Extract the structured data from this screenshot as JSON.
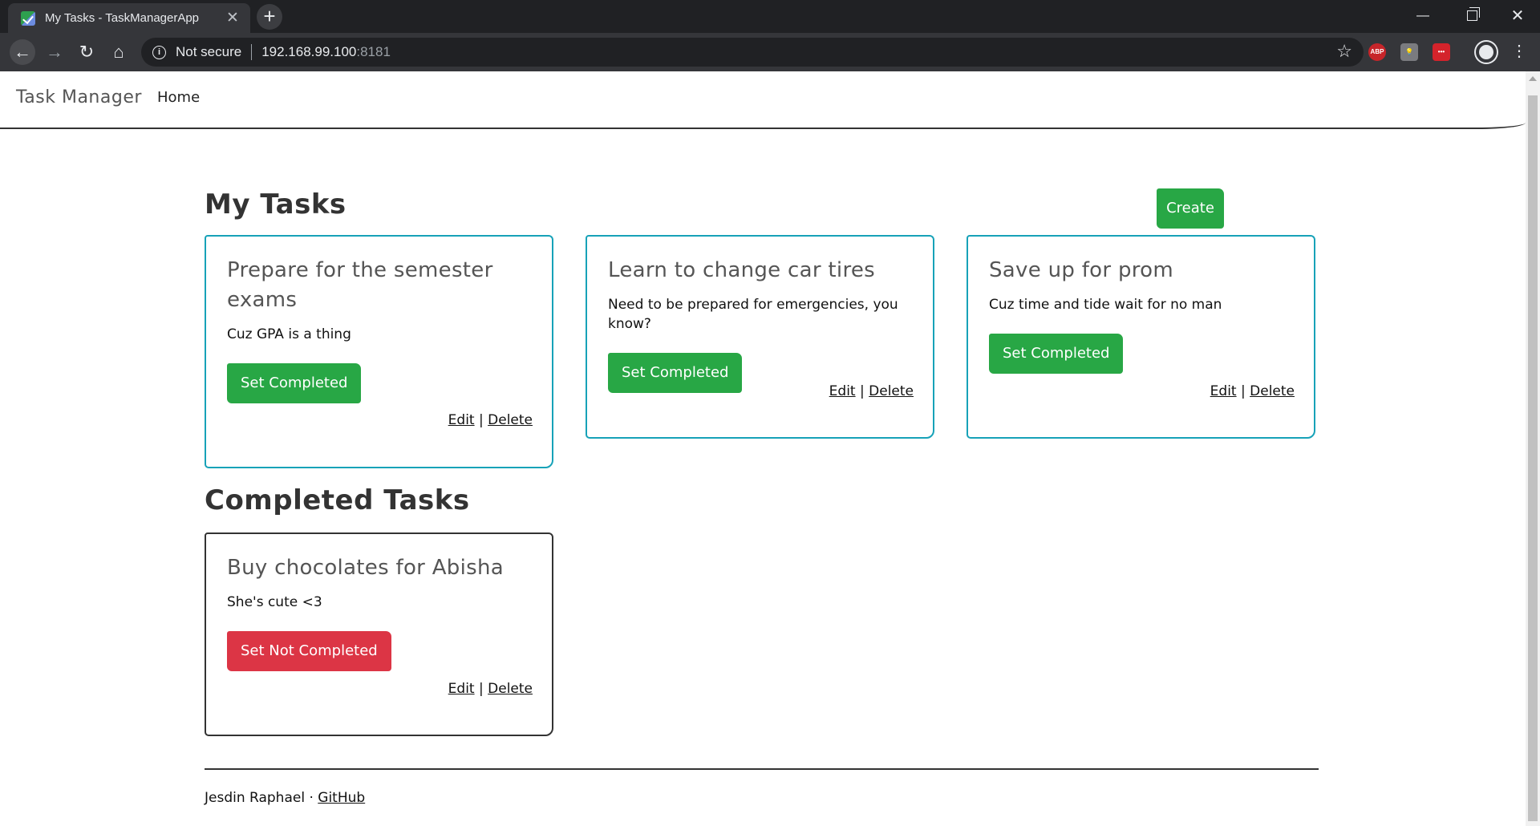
{
  "browser": {
    "tab_title": "My Tasks - TaskManagerApp",
    "security_label": "Not secure",
    "url_host": "192.168.99.100",
    "url_port": ":8181",
    "extensions": {
      "abp_label": "ABP",
      "dots_label": "•••"
    }
  },
  "navbar": {
    "brand": "Task Manager",
    "home_link": "Home"
  },
  "page": {
    "my_tasks_heading": "My Tasks",
    "create_button": "Create",
    "completed_heading": "Completed Tasks"
  },
  "tasks": [
    {
      "title": "Prepare for the semester exams",
      "description": "Cuz GPA is a thing",
      "action": "Set Completed"
    },
    {
      "title": "Learn to change car tires",
      "description": "Need to be prepared for emergencies, you know?",
      "action": "Set Completed"
    },
    {
      "title": "Save up for prom",
      "description": "Cuz time and tide wait for no man",
      "action": "Set Completed"
    }
  ],
  "completed_tasks": [
    {
      "title": "Buy chocolates for Abisha",
      "description": "She's cute <3",
      "action": "Set Not Completed"
    }
  ],
  "card_links": {
    "edit": "Edit",
    "separator": "|",
    "delete": "Delete"
  },
  "footer": {
    "author": "Jesdin Raphael",
    "separator": "·",
    "github_link": "GitHub"
  },
  "colors": {
    "success": "#28a745",
    "danger": "#dc3545",
    "pending_border": "#17a2b8",
    "completed_border": "#333333"
  }
}
